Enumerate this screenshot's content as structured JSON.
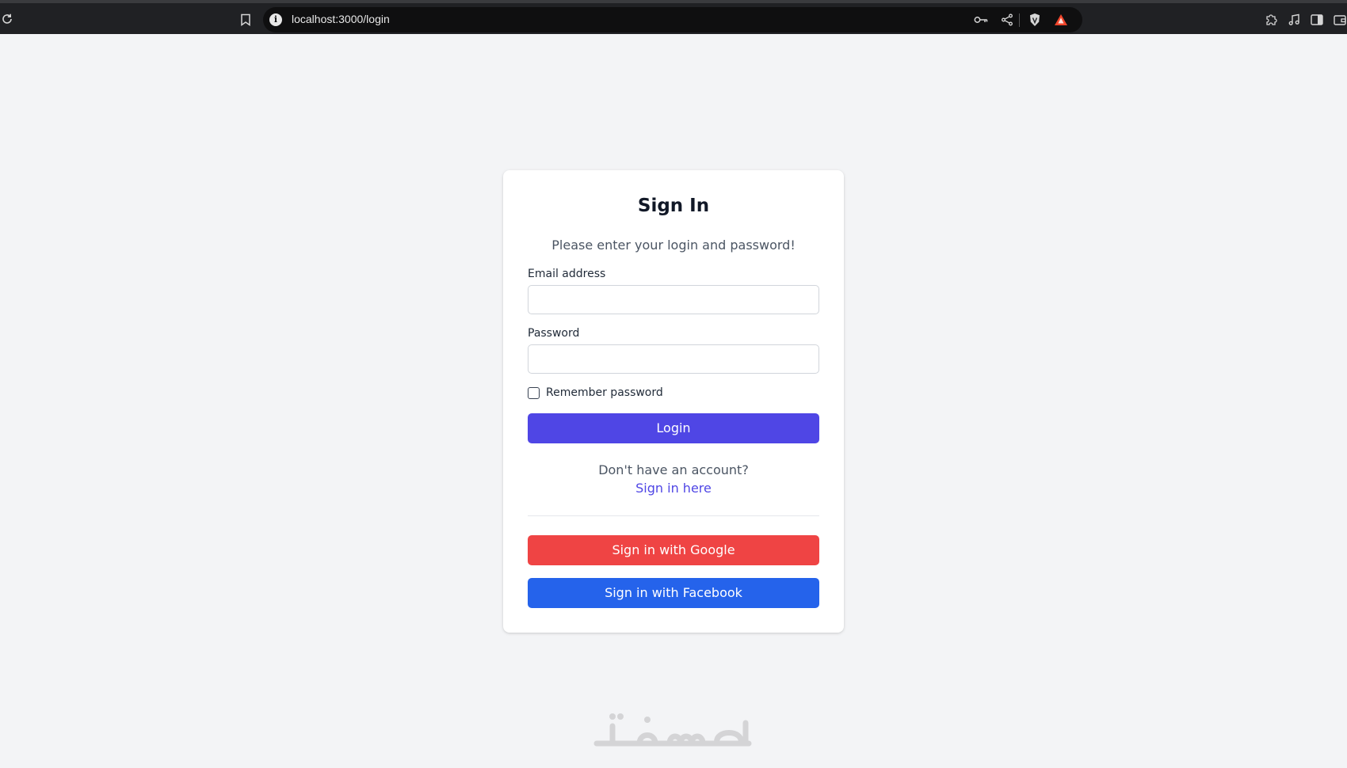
{
  "browser": {
    "url": "localhost:3000/login"
  },
  "login_form": {
    "title": "Sign In",
    "subtitle": "Please enter your login and password!",
    "email_label": "Email address",
    "email_value": "",
    "password_label": "Password",
    "password_value": "",
    "remember_label": "Remember password",
    "remember_checked": false,
    "login_button": "Login",
    "no_account_text": "Don't have an account?",
    "signup_link": "Sign in here",
    "google_button": "Sign in with Google",
    "facebook_button": "Sign in with Facebook"
  },
  "colors": {
    "page_background": "#f3f4f6",
    "login_button": "#4f46e5",
    "google_button": "#ef4444",
    "facebook_button": "#2563eb",
    "link": "#4f46e5"
  },
  "watermark": {
    "text": "خمسات"
  }
}
